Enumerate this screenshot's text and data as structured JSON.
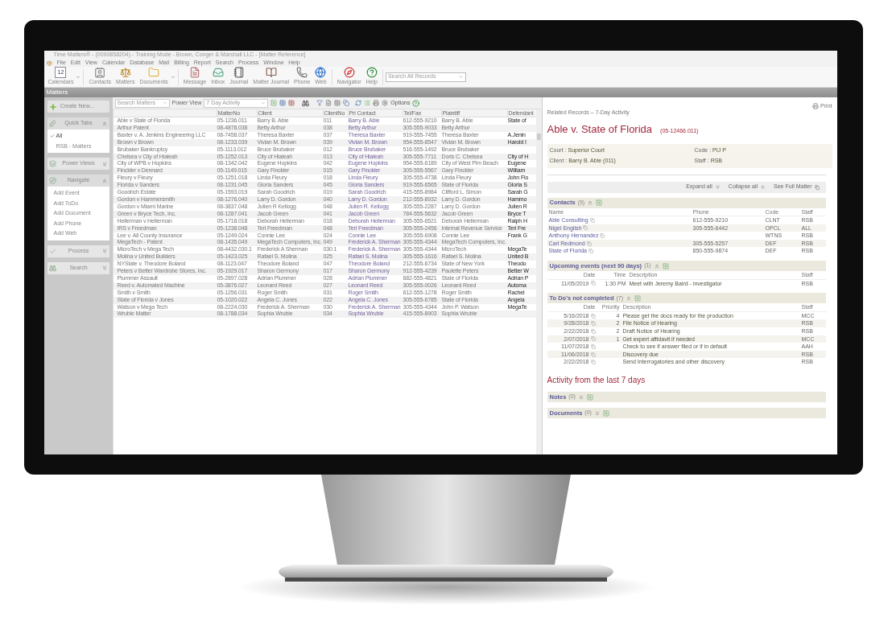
{
  "window": {
    "title": "Time Matters® - (0090858204) - Training Mode - Brown, Conger & Marshall LLC - [Matter Reference]"
  },
  "menu": [
    "File",
    "Edit",
    "View",
    "Calendar",
    "Database",
    "Mail",
    "Billing",
    "Report",
    "Search",
    "Process",
    "Window",
    "Help"
  ],
  "toolbar": {
    "calendar_day": "12",
    "buttons": [
      {
        "label": "Calendars",
        "dropdown": true
      },
      {
        "label": "Contacts",
        "dropdown": false
      },
      {
        "label": "Matters",
        "dropdown": false
      },
      {
        "label": "Documents",
        "dropdown": true
      },
      {
        "label": "Message",
        "dropdown": false
      },
      {
        "label": "Inbox",
        "dropdown": false
      },
      {
        "label": "Journal",
        "dropdown": false
      },
      {
        "label": "Matter Journal",
        "dropdown": false
      },
      {
        "label": "Phone",
        "dropdown": false
      },
      {
        "label": "Web",
        "dropdown": false
      },
      {
        "label": "Navigator",
        "dropdown": false
      },
      {
        "label": "Help",
        "dropdown": false
      }
    ],
    "search": {
      "placeholder": "Search All Records"
    }
  },
  "module_title": "Matters",
  "sidebar": {
    "create": "Create New...",
    "panels": [
      {
        "title": "Quick Tabs",
        "expanded": true,
        "items": [
          {
            "label": "All",
            "selected": true
          },
          {
            "label": "RSB - Matters",
            "selected": false
          }
        ]
      },
      {
        "title": "Power Views",
        "expanded": false
      },
      {
        "title": "Navigate",
        "expanded": true,
        "links": [
          "Add Event",
          "Add ToDo",
          "Add Document",
          "Add Phone",
          "Add Web"
        ]
      },
      {
        "title": "Process",
        "expanded": false
      },
      {
        "title": "Search",
        "expanded": false
      }
    ]
  },
  "list_toolbar": {
    "search": {
      "placeholder": "Search Matters"
    },
    "power_view_label": "Power View",
    "power_view": "7 Day Activity",
    "options": "Options"
  },
  "table": {
    "columns": [
      "MatterNo",
      "Client",
      "ClientNo",
      "Pri Contact",
      "Tel/Fax",
      "Plaintiff",
      "Defendant"
    ],
    "rows": [
      {
        "matter": "Able v State of Florida",
        "cells": [
          "05-1236.011",
          "Barry B. Able",
          "011",
          "Barry B. Able",
          "612-555-9210",
          "Barry B. Able",
          "State of"
        ]
      },
      {
        "matter": "Arthur Patent",
        "cells": [
          "08-4878.038",
          "Betty Arthur",
          "038",
          "Betty Arthur",
          "305-555-9033",
          "Betty Arthur",
          null
        ]
      },
      {
        "matter": "Baxter v. A. Jenkins Engineering LLC",
        "cells": [
          "08-7458.037",
          "Theresa Baxter",
          "037",
          "Theresa Baxter",
          "919-555-7455",
          "Theresa Baxter",
          "A.Jenin"
        ]
      },
      {
        "matter": "Brown v Brown",
        "cells": [
          "08-1233.039",
          "Vivian M. Brown",
          "039",
          "Vivian M. Brown",
          "954-555-8547",
          "Vivian M. Brown",
          "Harold I"
        ]
      },
      {
        "matter": "Brubaker Bankruptcy",
        "cells": [
          "05-1113.012",
          "Bruce Brubaker",
          "012",
          "Bruce Brubaker",
          "516-555-1492",
          "Bruce Brubaker",
          null
        ]
      },
      {
        "matter": "Chelsea v City of Hialeah",
        "cells": [
          "05-1252.013",
          "City of Hialeah",
          "013",
          "City of Hialeah",
          "305-555-7711",
          "Doris C. Chelsea",
          "City of H"
        ]
      },
      {
        "matter": "City of WPB v Hopkins",
        "cells": [
          "08-1342.042",
          "Eugene Hopkins",
          "042",
          "Eugene Hopkins",
          "954-555-6189",
          "City of West Plm Beach",
          "Eugene"
        ]
      },
      {
        "matter": "Finckler v Dennard",
        "cells": [
          "05-1149.015",
          "Gary Finckler",
          "015",
          "Gary Finckler",
          "305-555-5567",
          "Gary Finckler",
          "William"
        ]
      },
      {
        "matter": "Fleury v Fleury",
        "cells": [
          "05-1251.018",
          "Linda Fleury",
          "018",
          "Linda Fleury",
          "305-555-4738",
          "Linda Fleury",
          "John Flo"
        ]
      },
      {
        "matter": "Florida v Sanders",
        "cells": [
          "08-1231.045",
          "Gloria Sanders",
          "045",
          "Gloria Sanders",
          "919-555-6565",
          "State of Florida",
          "Gloria S"
        ]
      },
      {
        "matter": "Goodrich Estate",
        "cells": [
          "05-1593.019",
          "Sarah Goodrich",
          "019",
          "Sarah Goodrich",
          "415-555-8984",
          "Clifford L. Simon",
          "Sarah G"
        ]
      },
      {
        "matter": "Gordon v Hammersmith",
        "cells": [
          "08-1276.040",
          "Larry D. Gordon",
          "040",
          "Larry D. Gordon",
          "212-555-8932",
          "Larry D. Gordon",
          "Hammo"
        ]
      },
      {
        "matter": "Gordon v Miami Marine",
        "cells": [
          "08-3837.048",
          "Julien R Kellogg",
          "048",
          "Julien R. Kellogg",
          "305-555-2287",
          "Larry D. Gordon",
          "Julien R"
        ]
      },
      {
        "matter": "Green v Bryce Tech, Inc.",
        "cells": [
          "08-1287.041",
          "Jacob Green",
          "041",
          "Jacob Green",
          "784-555-5632",
          "Jacob Green",
          "Bryce T"
        ]
      },
      {
        "matter": "Hellerman v Hellerman",
        "cells": [
          "05-1718.018",
          "Deborah Hellerman",
          "018",
          "Deborah Hellerman",
          "305-555-6521",
          "Deborah Hellerman",
          "Ralph H"
        ]
      },
      {
        "matter": "IRS v Freedman",
        "cells": [
          "05-1238.048",
          "Teri Freedman",
          "048",
          "Teri Freedman",
          "305-555-2456",
          "Internal Revenue Service",
          "Teri Fre"
        ]
      },
      {
        "matter": "Lee v. All County Insurance",
        "cells": [
          "05-1249.024",
          "Connie Lee",
          "024",
          "Connie Lee",
          "305-555-6908",
          "Connie Lee",
          "Frank G"
        ]
      },
      {
        "matter": "MegaTech - Patent",
        "cells": [
          "08-1435.049",
          "MegaTech Computers, Inc.",
          "049",
          "Frederick A. Sherman",
          "305-555-4344",
          "MegaTech Computers, Inc.",
          null
        ]
      },
      {
        "matter": "MicroTech v Mega Tech",
        "cells": [
          "08-4432.030.1",
          "Frederick A Sherman",
          "030.1",
          "Frederick A. Sherman",
          "305-555-4344",
          "MicroTech",
          "MegaTe"
        ]
      },
      {
        "matter": "Molina v United Builders",
        "cells": [
          "05-1423.025",
          "Rafael S. Molina",
          "025",
          "Rafael S. Molina",
          "305-555-1616",
          "Rafael S. Molina",
          "United B"
        ]
      },
      {
        "matter": "NYState v. Theodore Boland",
        "cells": [
          "08-1123.047",
          "Theodore Boland",
          "047",
          "Theodore Boland",
          "212-555-6734",
          "State of New York",
          "Theodo"
        ]
      },
      {
        "matter": "Peters v Better Wardrobe Stores, Inc.",
        "cells": [
          "05-1929.017",
          "Sharon Germony",
          "017",
          "Sharon Germony",
          "912-555-4239",
          "Paulette Peters",
          "Better W"
        ]
      },
      {
        "matter": "Plummer Assault",
        "cells": [
          "05-2897.028",
          "Adrian Plummer",
          "028",
          "Adrian Plummer",
          "682-555-4821",
          "State of Florida",
          "Adrian P"
        ]
      },
      {
        "matter": "Reed v. Automated Machine",
        "cells": [
          "05-3876.027",
          "Leonard Reed",
          "027",
          "Leonard Reed",
          "305-555-0026",
          "Leonard Reed",
          "Automa"
        ]
      },
      {
        "matter": "Smith v Smith",
        "cells": [
          "05-1256.031",
          "Roger Smith",
          "031",
          "Roger Smith",
          "612-555-1278",
          "Roger Smith",
          "Rachel"
        ]
      },
      {
        "matter": "State of Florida v Jones",
        "cells": [
          "05-1020.022",
          "Angela C. Jones",
          "022",
          "Angela C. Jones",
          "305-555-6785",
          "State of Florida",
          "Angela"
        ]
      },
      {
        "matter": "Watson v Mega Tech",
        "cells": [
          "08-2224.030",
          "Frederick A. Sherman",
          "030",
          "Frederick A. Sherman",
          "305-555-4344",
          "John P. Watson",
          "MegaTe"
        ]
      },
      {
        "matter": "Wruble Matter",
        "cells": [
          "08-1788.034",
          "Sophia Wruble",
          "034",
          "Sophia Wruble",
          "415-555-8903",
          "Sophia Wruble",
          null
        ]
      }
    ]
  },
  "detail": {
    "breadcrumb": "Related Records – 7-Day Activity",
    "print": "Print",
    "title": "Able v. State of Florida",
    "number": "(05-12466.011)",
    "fields": [
      {
        "label": "Court :",
        "value": "Superior Court"
      },
      {
        "label": "Code :",
        "value": "PIJ P"
      },
      {
        "label": "Client :",
        "value": "Barry B. Able (011)"
      },
      {
        "label": "Staff :",
        "value": "RSB"
      }
    ],
    "actions": [
      {
        "label": "Expand all",
        "kind": "expand"
      },
      {
        "label": "Collapse all",
        "kind": "collapse"
      },
      {
        "label": "See Full Matter",
        "kind": "link"
      }
    ],
    "sections": [
      {
        "title": "Contacts",
        "count": "(5)",
        "expanded": true,
        "kind": "contacts",
        "columns": [
          "Name",
          "Phone",
          "Code",
          "Staff"
        ],
        "rows": [
          [
            "Able Consulting",
            "612-555-9210",
            "CLNT",
            "RSB"
          ],
          [
            "Nigel English",
            "305-555-6442",
            "OPCL",
            "ALL"
          ],
          [
            "Anthony Hernandez",
            null,
            "WTNS",
            "RSB"
          ],
          [
            "Carl Redmond",
            "305-555-5257",
            "DEF",
            "RSB"
          ],
          [
            "State of Florida",
            "850-555-9874",
            "DEF",
            "RSB"
          ]
        ]
      },
      {
        "title": "Upcoming events (next 90 days)",
        "count": "(1)",
        "expanded": true,
        "kind": "events",
        "columns": [
          "Date",
          "Time",
          "Description",
          "Staff"
        ],
        "rows": [
          [
            "11/05/2019",
            "1:30 PM",
            "Meet with Jeremy Baird - investigator",
            "RSB"
          ]
        ]
      },
      {
        "title": "To Do's not completed",
        "count": "(7)",
        "expanded": true,
        "kind": "todos",
        "columns": [
          "Date",
          "Priority",
          "Description",
          "Staff"
        ],
        "rows": [
          [
            "5/16/2018",
            "4",
            "Please get the docs ready for the production",
            "MCC"
          ],
          [
            "9/28/2018",
            "2",
            "File Notice of Hearing",
            "RSB"
          ],
          [
            "2/22/2018",
            "2",
            "Draft Notice of Hearing",
            "RSB"
          ],
          [
            "2/07/2018",
            "1",
            "Get expert affidavit if needed",
            "MCC"
          ],
          [
            "11/07/2018",
            null,
            "Check to see if answer filed or if in default",
            "AAH"
          ],
          [
            "11/06/2018",
            null,
            "Discovery due",
            "RSB"
          ],
          [
            "2/22/2018",
            null,
            "Send Interrogatories and other discovery",
            "RSB"
          ]
        ]
      }
    ],
    "activity_heading": "Activity from the last 7 days",
    "activity_sections": [
      {
        "title": "Notes",
        "count": "(0)",
        "expanded": false
      },
      {
        "title": "Documents",
        "count": "(0)",
        "expanded": false
      }
    ]
  }
}
